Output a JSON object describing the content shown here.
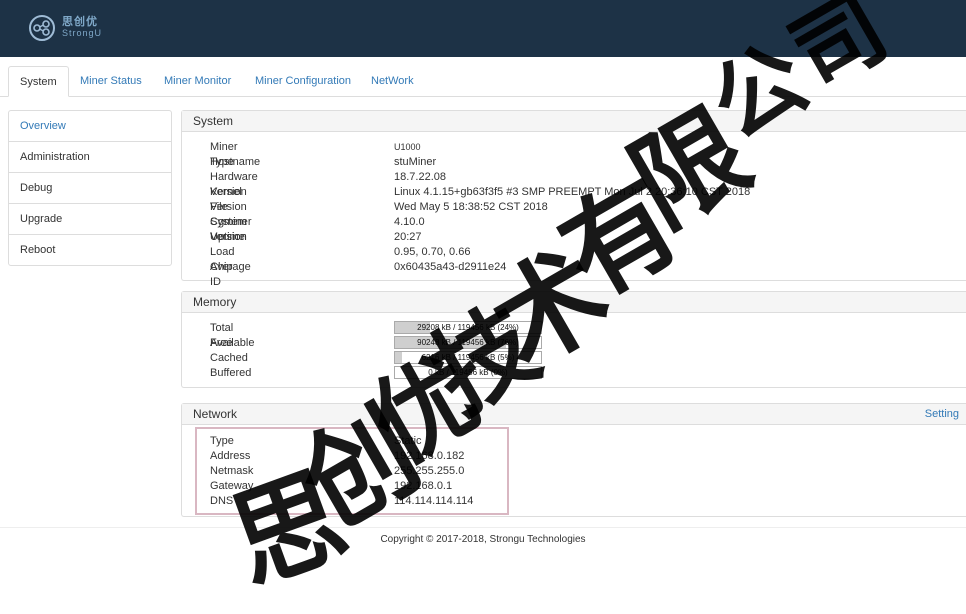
{
  "brand": {
    "name_cn": "思创优",
    "name_en": "StrongU"
  },
  "tabs": [
    "System",
    "Miner Status",
    "Miner Monitor",
    "Miner Configuration",
    "NetWork"
  ],
  "sidebar": [
    "Overview",
    "Administration",
    "Debug",
    "Upgrade",
    "Reboot"
  ],
  "system": {
    "title": "System",
    "rows": [
      {
        "label": "Miner Type",
        "value": "U1000"
      },
      {
        "label": "Hostname",
        "value": "stuMiner"
      },
      {
        "label": "Hardware Version",
        "value": "18.7.22.08"
      },
      {
        "label": "Kernel Version",
        "value": "Linux 4.1.15+gb63f3f5 #3 SMP PREEMPT Mon Jul 2 20:36:10 CST 2018"
      },
      {
        "label": "File System Version",
        "value": "Wed May 5 18:38:52 CST 2018"
      },
      {
        "label": "Cgminer Version",
        "value": "4.10.0"
      },
      {
        "label": "Uptime",
        "value": "20:27"
      },
      {
        "label": "Load Average",
        "value": "0.95, 0.70, 0.66"
      },
      {
        "label": "Chip ID",
        "value": "0x60435a43-d2911e24"
      }
    ]
  },
  "memory": {
    "title": "Memory",
    "rows": [
      {
        "label": "Total Available",
        "text": "29208 kB / 119456 kB (24%)",
        "fraction": 0.24
      },
      {
        "label": "Free",
        "text": "90248 kB / 119456 kB (76%)",
        "fraction": 0.76
      },
      {
        "label": "Cached",
        "text": "6216 kB / 119456 kB (5%)",
        "fraction": 0.05
      },
      {
        "label": "Buffered",
        "text": "0 kB / 119456 kB (0%)",
        "fraction": 0.0
      }
    ]
  },
  "network": {
    "title": "Network",
    "setting_label": "Setting",
    "rows": [
      {
        "label": "Type",
        "value": "Static"
      },
      {
        "label": "Address",
        "value": "192.168.0.182"
      },
      {
        "label": "Netmask",
        "value": "255.255.255.0"
      },
      {
        "label": "Gateway",
        "value": "192.168.0.1"
      },
      {
        "label": "DNS",
        "value": "114.114.114.114"
      }
    ]
  },
  "footer": "Copyright © 2017-2018, Strongu Technologies",
  "watermark": "思创优技术有限公司",
  "colors": {
    "header": "#1d3246",
    "link": "#337ab7",
    "highlight": "#d9b7c2"
  }
}
